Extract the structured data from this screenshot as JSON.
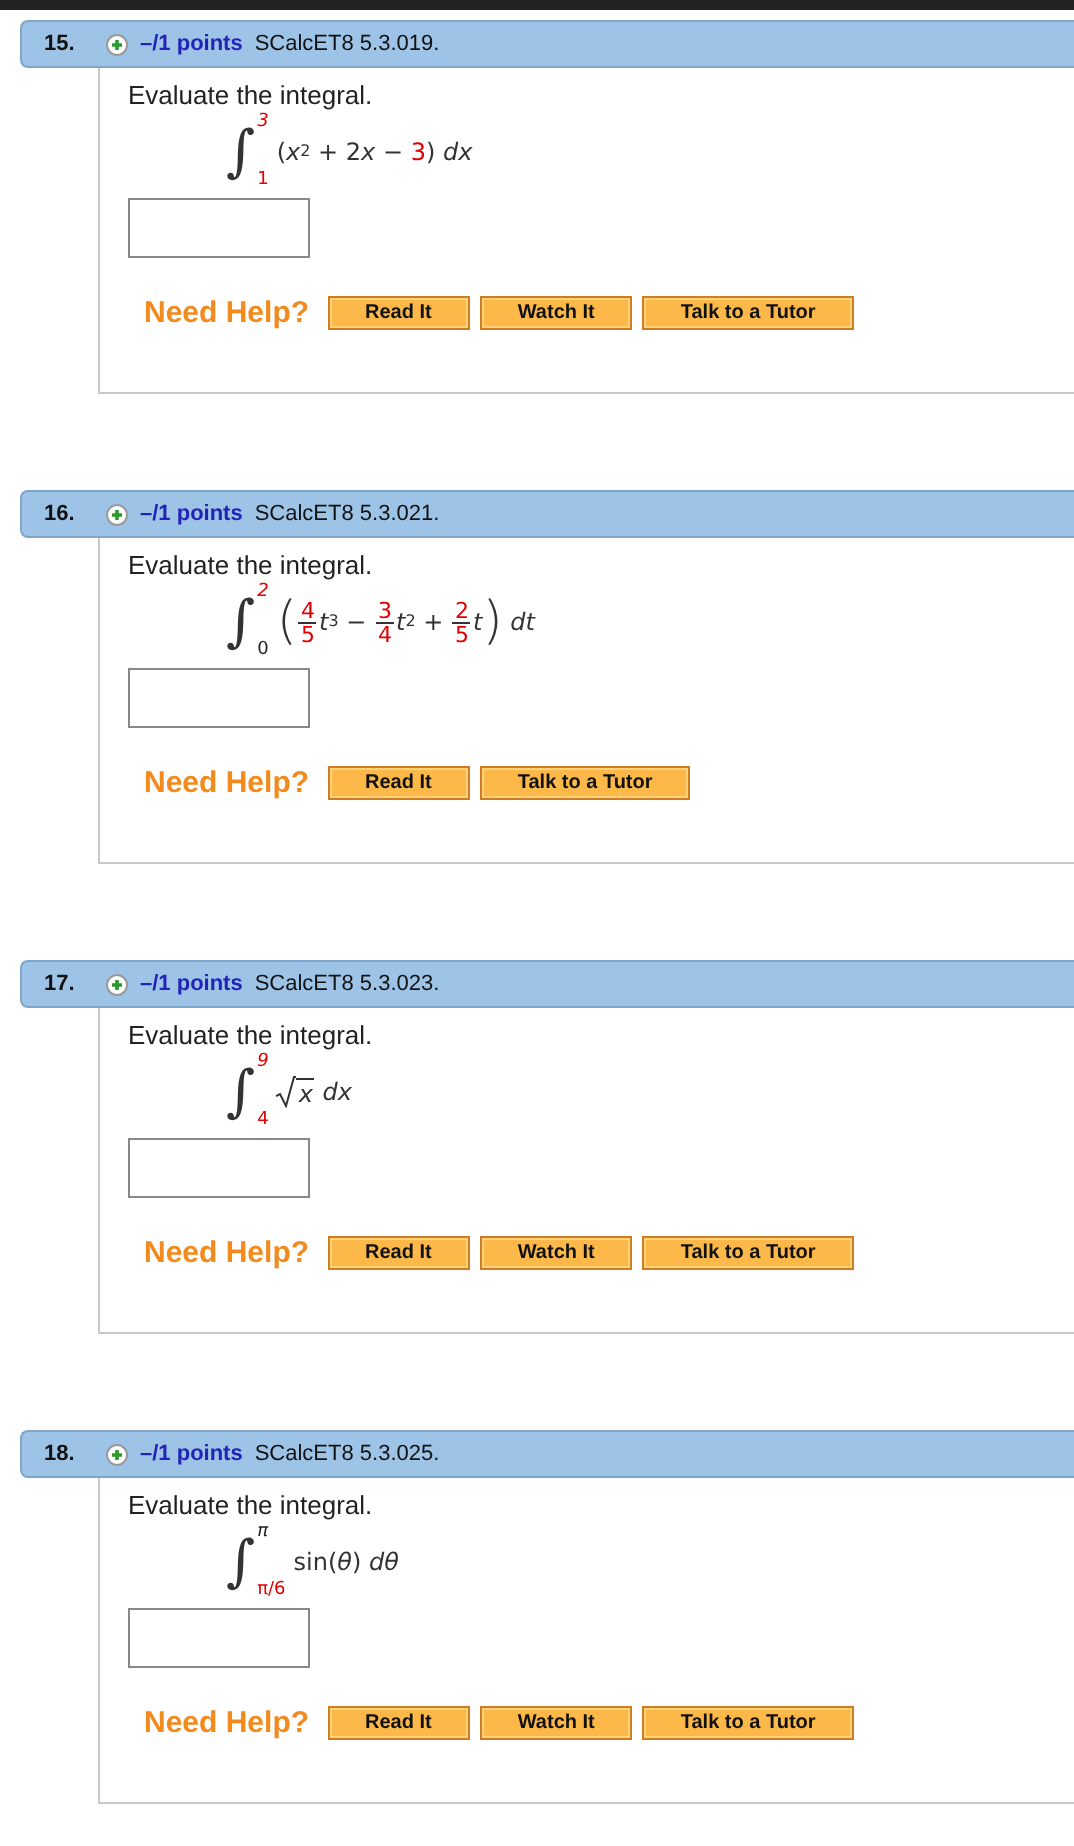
{
  "problems": [
    {
      "number": "15.",
      "points": "–/1 points",
      "code": "SCalcET8 5.3.019.",
      "prompt": "Evaluate the integral.",
      "sign": "∫",
      "lower": {
        "text": "1",
        "given": true
      },
      "upper": {
        "text": "3",
        "given": true
      },
      "integrand": [
        {
          "kind": "text",
          "text": "("
        },
        {
          "kind": "var",
          "text": "x"
        },
        {
          "kind": "sup",
          "text": "2"
        },
        {
          "kind": "text",
          "text": " + 2"
        },
        {
          "kind": "var",
          "text": "x"
        },
        {
          "kind": "text",
          "text": " − "
        },
        {
          "kind": "given",
          "text": "3"
        },
        {
          "kind": "text",
          "text": ") "
        },
        {
          "kind": "var",
          "text": "dx"
        }
      ],
      "help": "Need Help?",
      "buttons": [
        "Read It",
        "Watch It",
        "Talk to a Tutor"
      ]
    },
    {
      "number": "16.",
      "points": "–/1 points",
      "code": "SCalcET8 5.3.021.",
      "prompt": "Evaluate the integral.",
      "sign": "∫",
      "lower": {
        "text": "0",
        "given": false
      },
      "upper": {
        "text": "2",
        "given": true
      },
      "integrand": [
        {
          "kind": "paren",
          "text": "("
        },
        {
          "kind": "frac",
          "num": "4",
          "den": "5"
        },
        {
          "kind": "var",
          "text": "t"
        },
        {
          "kind": "sup",
          "text": "3"
        },
        {
          "kind": "text",
          "text": " − "
        },
        {
          "kind": "frac",
          "num": "3",
          "den": "4"
        },
        {
          "kind": "var",
          "text": "t"
        },
        {
          "kind": "sup",
          "text": "2"
        },
        {
          "kind": "text",
          "text": " + "
        },
        {
          "kind": "frac",
          "num": "2",
          "den": "5"
        },
        {
          "kind": "var",
          "text": "t"
        },
        {
          "kind": "paren",
          "text": ")"
        },
        {
          "kind": "var",
          "text": " dt"
        }
      ],
      "help": "Need Help?",
      "buttons": [
        "Read It",
        "Talk to a Tutor"
      ]
    },
    {
      "number": "17.",
      "points": "–/1 points",
      "code": "SCalcET8 5.3.023.",
      "prompt": "Evaluate the integral.",
      "sign": "∫",
      "lower": {
        "text": "4",
        "given": true
      },
      "upper": {
        "text": "9",
        "given": true
      },
      "integrand": [
        {
          "kind": "sqrt",
          "text": "x"
        },
        {
          "kind": "var",
          "text": " dx"
        }
      ],
      "help": "Need Help?",
      "buttons": [
        "Read It",
        "Watch It",
        "Talk to a Tutor"
      ]
    },
    {
      "number": "18.",
      "points": "–/1 points",
      "code": "SCalcET8 5.3.025.",
      "prompt": "Evaluate the integral.",
      "sign": "∫",
      "lower": {
        "text": "π/6",
        "given": true
      },
      "upper": {
        "text": "π",
        "given": false
      },
      "integrand": [
        {
          "kind": "text",
          "text": "sin("
        },
        {
          "kind": "var",
          "text": "θ"
        },
        {
          "kind": "text",
          "text": ") "
        },
        {
          "kind": "var",
          "text": "dθ"
        }
      ],
      "help": "Need Help?",
      "buttons": [
        "Read It",
        "Watch It",
        "Talk to a Tutor"
      ]
    }
  ]
}
